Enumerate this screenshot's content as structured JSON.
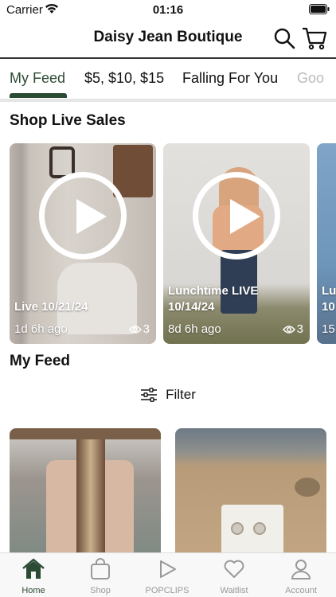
{
  "status_bar": {
    "carrier": "Carrier",
    "time": "01:16"
  },
  "header": {
    "title": "Daisy Jean Boutique"
  },
  "tabs": [
    {
      "label": "My Feed",
      "active": true
    },
    {
      "label": "$5, $10, $15",
      "active": false
    },
    {
      "label": "Falling For You",
      "active": false
    },
    {
      "label": "Goo",
      "active": false
    }
  ],
  "live_sales": {
    "heading": "Shop Live Sales",
    "cards": [
      {
        "title_lines": [
          "Live 10/21/24"
        ],
        "age": "1d 6h ago",
        "views": "3"
      },
      {
        "title_lines": [
          "Lunchtime LIVE",
          "10/14/24"
        ],
        "age": "8d 6h ago",
        "views": "3"
      },
      {
        "title_lines": [
          "Lu",
          "10"
        ],
        "age": "15",
        "views": ""
      }
    ]
  },
  "feed": {
    "heading": "My Feed",
    "filter_label": "Filter"
  },
  "bottom_nav": [
    {
      "label": "Home",
      "icon": "home-icon",
      "active": true
    },
    {
      "label": "Shop",
      "icon": "shopping-bag-icon",
      "active": false
    },
    {
      "label": "POPCLIPS",
      "icon": "play-icon",
      "active": false
    },
    {
      "label": "Waitlist",
      "icon": "heart-icon",
      "active": false
    },
    {
      "label": "Account",
      "icon": "person-icon",
      "active": false
    }
  ],
  "colors": {
    "accent": "#2c4b34",
    "inactive": "#999999",
    "divider": "#e6e6e6"
  }
}
